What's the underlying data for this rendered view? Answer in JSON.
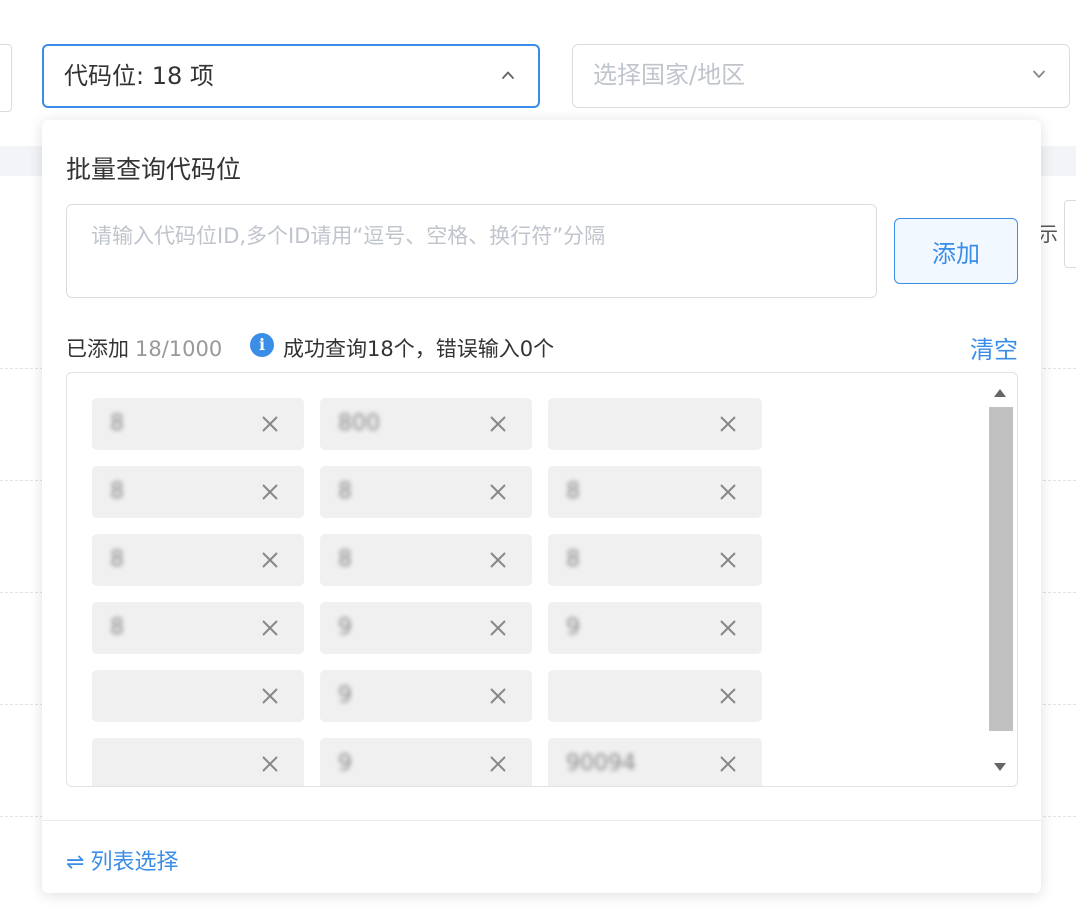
{
  "code_select": {
    "value": "代码位: 18 项",
    "icon": "chevron-up-icon",
    "accent_color": "#3b8ee8"
  },
  "country_select": {
    "placeholder": "选择国家/地区",
    "icon": "chevron-down-icon"
  },
  "panel": {
    "title": "批量查询代码位",
    "input_placeholder": "请输入代码位ID,多个ID请用“逗号、空格、换行符”分隔",
    "add_button": "添加",
    "added_label": "已添加",
    "added_count": "18/1000",
    "info_icon": "info-icon",
    "query_result": "成功查询18个，错误输入0个",
    "clear_link": "清空",
    "tags": [
      {
        "text": "8"
      },
      {
        "text": "800"
      },
      {
        "text": ""
      },
      {
        "text": "8"
      },
      {
        "text": "8"
      },
      {
        "text": "8"
      },
      {
        "text": "8"
      },
      {
        "text": "8"
      },
      {
        "text": "8"
      },
      {
        "text": "8"
      },
      {
        "text": "9"
      },
      {
        "text": "9"
      },
      {
        "text": ""
      },
      {
        "text": "9"
      },
      {
        "text": ""
      },
      {
        "text": ""
      },
      {
        "text": "9"
      },
      {
        "text": "90094"
      }
    ],
    "tag_remove_icon": "close-icon",
    "footer_icon": "swap-icon",
    "footer_link": "列表选择"
  },
  "background": {
    "right_fragment": "示"
  }
}
